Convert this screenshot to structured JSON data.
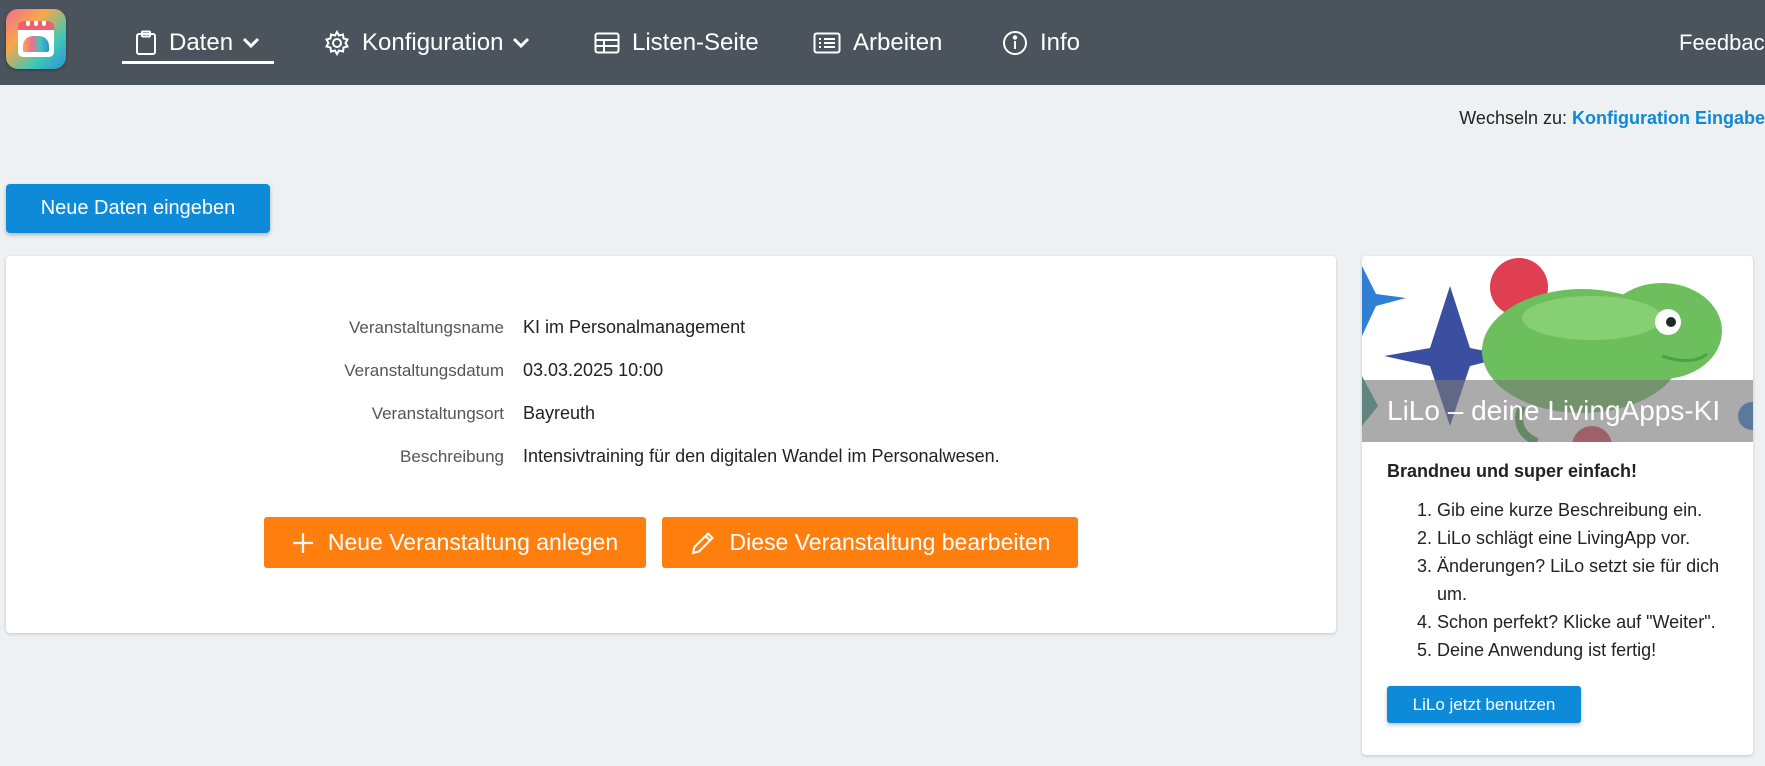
{
  "navbar": {
    "items": [
      {
        "label": "Daten",
        "icon": "clipboard-icon",
        "dropdown": true,
        "active": true
      },
      {
        "label": "Konfiguration",
        "icon": "gear-icon",
        "dropdown": true
      },
      {
        "label": "Listen-Seite",
        "icon": "table-icon"
      },
      {
        "label": "Arbeiten",
        "icon": "list-icon"
      },
      {
        "label": "Info",
        "icon": "info-icon"
      }
    ],
    "feedback_label": "Feedback"
  },
  "switch": {
    "prefix": "Wechseln zu:",
    "link": "Konfiguration Eingabe"
  },
  "actions": {
    "new_data_label": "Neue Daten eingeben"
  },
  "record": {
    "fields": [
      {
        "label": "Veranstaltungsname",
        "value": "KI im Personalmanagement"
      },
      {
        "label": "Veranstaltungsdatum",
        "value": "03.03.2025 10:00"
      },
      {
        "label": "Veranstaltungsort",
        "value": "Bayreuth"
      },
      {
        "label": "Beschreibung",
        "value": "Intensivtraining für den digitalen Wandel im Personalwesen."
      }
    ],
    "new_button_label": "Neue Veranstaltung anlegen",
    "edit_button_label": "Diese Veranstaltung bearbeiten"
  },
  "lilo": {
    "banner_title": "LiLo – deine LivingApps-KI",
    "heading": "Brandneu und super einfach!",
    "steps": [
      "Gib eine kurze Beschreibung ein.",
      "LiLo schlägt eine LivingApp vor.",
      "Änderungen? LiLo setzt sie für dich um.",
      "Schon perfekt? Klicke auf \"Weiter\".",
      "Deine Anwendung ist fertig!"
    ],
    "button_label": "LiLo jetzt benutzen"
  },
  "colors": {
    "navbar": "#4b545c",
    "primary_blue": "#0e8bd8",
    "action_orange": "#ff7f0e",
    "background": "#eef1f3"
  }
}
